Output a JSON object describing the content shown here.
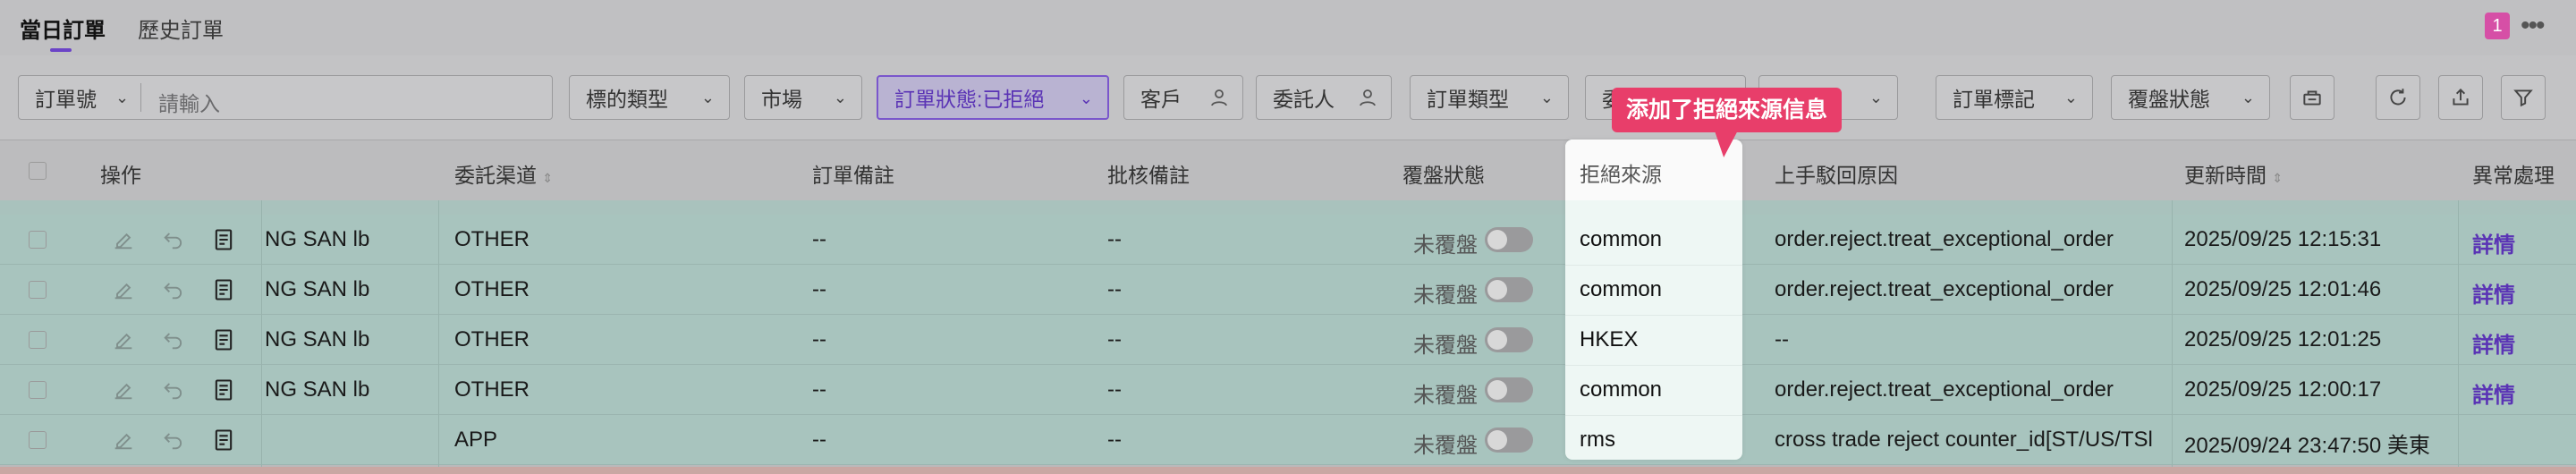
{
  "tabs": {
    "active": "當日訂單",
    "inactive": "歷史訂單"
  },
  "badge": "1",
  "more": "•••",
  "filters": {
    "order_no_label": "訂單號",
    "order_no_placeholder": "請輸入",
    "underlying_type": "標的類型",
    "market": "市場",
    "order_status": "訂單狀態:已拒絕",
    "customer": "客戶",
    "delegator": "委託人",
    "order_type": "訂單類型",
    "partial_hidden": "委",
    "order_flag": "訂單標記",
    "review_status": "覆盤狀態"
  },
  "callout": "添加了拒絕來源信息",
  "columns": {
    "actions": "操作",
    "channel": "委託渠道",
    "order_note": "訂單備註",
    "approval_note": "批核備註",
    "review_status": "覆盤狀態",
    "reject_source": "拒絕來源",
    "upstream_reason": "上手駁回原因",
    "update_time": "更新時間",
    "exception": "異常處理"
  },
  "rows": [
    {
      "name": "NG SAN lb",
      "channel": "OTHER",
      "order_note": "--",
      "approval_note": "--",
      "review": "未覆盤",
      "reject_source": "common",
      "reason": "order.reject.treat_exceptional_order",
      "time": "2025/09/25 12:15:31",
      "action": "詳情"
    },
    {
      "name": "NG SAN lb",
      "channel": "OTHER",
      "order_note": "--",
      "approval_note": "--",
      "review": "未覆盤",
      "reject_source": "common",
      "reason": "order.reject.treat_exceptional_order",
      "time": "2025/09/25 12:01:46",
      "action": "詳情"
    },
    {
      "name": "NG SAN lb",
      "channel": "OTHER",
      "order_note": "--",
      "approval_note": "--",
      "review": "未覆盤",
      "reject_source": "HKEX",
      "reason": "--",
      "time": "2025/09/25 12:01:25",
      "action": "詳情"
    },
    {
      "name": "NG SAN lb",
      "channel": "OTHER",
      "order_note": "--",
      "approval_note": "--",
      "review": "未覆盤",
      "reject_source": "common",
      "reason": "order.reject.treat_exceptional_order",
      "time": "2025/09/25 12:00:17",
      "action": "詳情"
    },
    {
      "name": "",
      "channel": "APP",
      "order_note": "--",
      "approval_note": "--",
      "review": "未覆盤",
      "reject_source": "rms",
      "reason": "cross trade reject counter_id[ST/US/TSl",
      "time": "2025/09/24 23:47:50 美東",
      "action": ""
    }
  ]
}
